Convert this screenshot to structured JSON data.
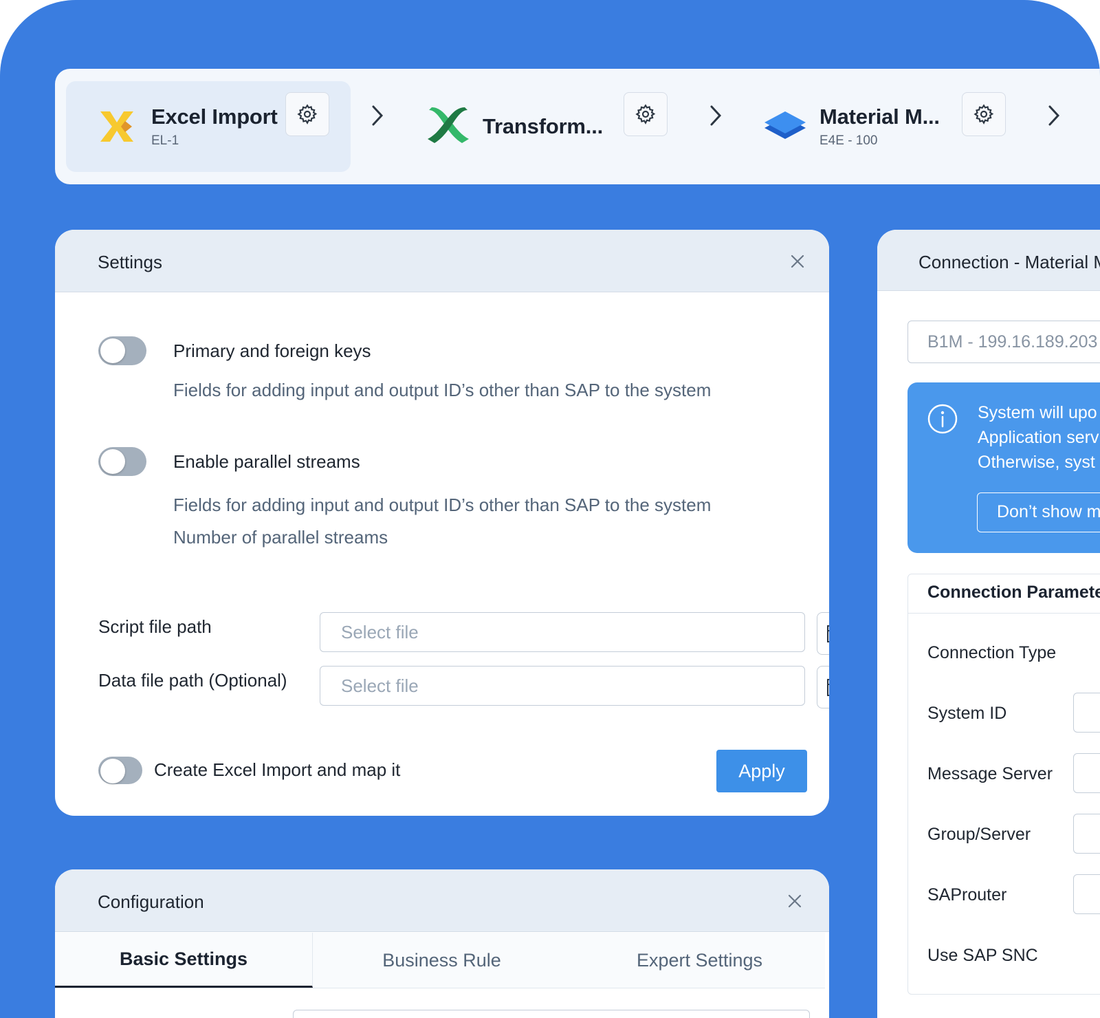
{
  "pipeline": {
    "steps": [
      {
        "name": "Excel Import",
        "code": "EL-1"
      },
      {
        "name": "Transform...",
        "code": ""
      },
      {
        "name": "Material M...",
        "code": "E4E - 100"
      }
    ],
    "icons": {
      "settings": "gear-icon",
      "next": "chevron-right-icon"
    }
  },
  "settings": {
    "title": "Settings",
    "options": [
      {
        "label": "Primary and foreign keys",
        "description": "Fields for adding input and output ID’s other than SAP to the system"
      },
      {
        "label": "Enable parallel streams",
        "description": "Fields for adding input and output ID’s other than SAP to the system",
        "extra": "Number of parallel streams"
      }
    ],
    "script_label": "Script file path",
    "script_placeholder": "Select file",
    "data_label": "Data file path (Optional)",
    "data_placeholder": "Select file",
    "create_label": "Create Excel Import and map it",
    "apply_label": "Apply"
  },
  "configuration": {
    "title": "Configuration",
    "tabs": [
      "Basic Settings",
      "Business Rule",
      "Expert Settings"
    ],
    "active_tab": "Basic Settings"
  },
  "connection": {
    "title": "Connection - Material M",
    "system_value": "B1M - 199.16.189.203",
    "info_lines": [
      "System will upo",
      "Application serv",
      "Otherwise, syst"
    ],
    "dont_show_label": "Don’t show m",
    "params_title": "Connection Paramete",
    "params": [
      "Connection Type",
      "System ID",
      "Message Server",
      "Group/Server",
      "SAProuter",
      "Use SAP SNC"
    ]
  },
  "colors": {
    "background": "#3a7de0",
    "primary_button": "#3d90e8",
    "info_box": "#4a98ec",
    "toggle_off": "#a4b0bd"
  }
}
